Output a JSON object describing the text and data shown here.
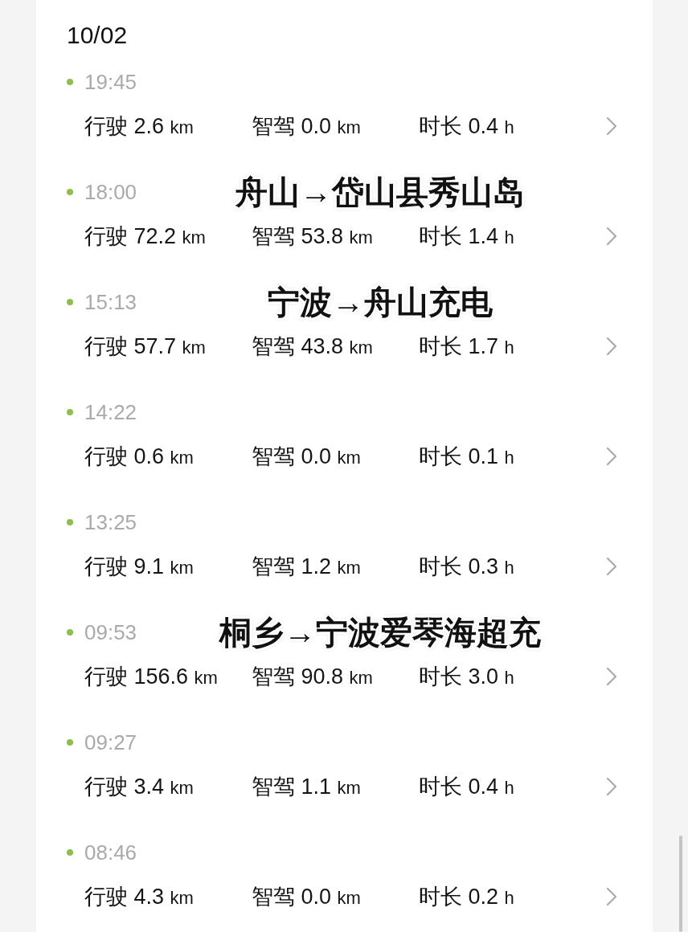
{
  "date": "10/02",
  "trips": [
    {
      "time": "19:45",
      "stats": [
        {
          "label": "行驶",
          "value": "2.6",
          "unit": "km"
        },
        {
          "label": "智驾",
          "value": "0.0",
          "unit": "km"
        },
        {
          "label": "时长",
          "value": "0.4",
          "unit": "h"
        }
      ]
    },
    {
      "time": "18:00",
      "caption": "舟山→岱山县秀山岛",
      "stats": [
        {
          "label": "行驶",
          "value": "72.2",
          "unit": "km"
        },
        {
          "label": "智驾",
          "value": "53.8",
          "unit": "km"
        },
        {
          "label": "时长",
          "value": "1.4",
          "unit": "h"
        }
      ]
    },
    {
      "time": "15:13",
      "caption": "宁波→舟山充电",
      "stats": [
        {
          "label": "行驶",
          "value": "57.7",
          "unit": "km"
        },
        {
          "label": "智驾",
          "value": "43.8",
          "unit": "km"
        },
        {
          "label": "时长",
          "value": "1.7",
          "unit": "h"
        }
      ]
    },
    {
      "time": "14:22",
      "stats": [
        {
          "label": "行驶",
          "value": "0.6",
          "unit": "km"
        },
        {
          "label": "智驾",
          "value": "0.0",
          "unit": "km"
        },
        {
          "label": "时长",
          "value": "0.1",
          "unit": "h"
        }
      ]
    },
    {
      "time": "13:25",
      "stats": [
        {
          "label": "行驶",
          "value": "9.1",
          "unit": "km"
        },
        {
          "label": "智驾",
          "value": "1.2",
          "unit": "km"
        },
        {
          "label": "时长",
          "value": "0.3",
          "unit": "h"
        }
      ]
    },
    {
      "time": "09:53",
      "caption": "桐乡→宁波爱琴海超充",
      "stats": [
        {
          "label": "行驶",
          "value": "156.6",
          "unit": "km"
        },
        {
          "label": "智驾",
          "value": "90.8",
          "unit": "km"
        },
        {
          "label": "时长",
          "value": "3.0",
          "unit": "h"
        }
      ]
    },
    {
      "time": "09:27",
      "stats": [
        {
          "label": "行驶",
          "value": "3.4",
          "unit": "km"
        },
        {
          "label": "智驾",
          "value": "1.1",
          "unit": "km"
        },
        {
          "label": "时长",
          "value": "0.4",
          "unit": "h"
        }
      ]
    },
    {
      "time": "08:46",
      "stats": [
        {
          "label": "行驶",
          "value": "4.3",
          "unit": "km"
        },
        {
          "label": "智驾",
          "value": "0.0",
          "unit": "km"
        },
        {
          "label": "时长",
          "value": "0.2",
          "unit": "h"
        }
      ]
    }
  ]
}
